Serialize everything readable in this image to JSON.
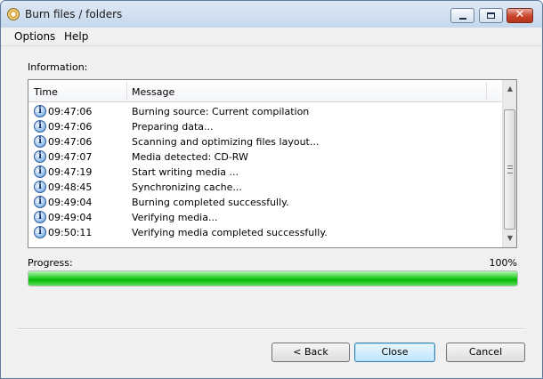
{
  "window": {
    "title": "Burn files / folders",
    "close_glyph": "✕"
  },
  "menu": {
    "options": "Options",
    "help": "Help"
  },
  "information": {
    "label": "Information:",
    "columns": {
      "time": "Time",
      "message": "Message"
    },
    "rows": [
      {
        "time": "09:47:06",
        "message": "Burning source:  Current compilation"
      },
      {
        "time": "09:47:06",
        "message": "Preparing data..."
      },
      {
        "time": "09:47:06",
        "message": "Scanning and optimizing files layout..."
      },
      {
        "time": "09:47:07",
        "message": "Media detected: CD-RW"
      },
      {
        "time": "09:47:19",
        "message": "Start writing media ..."
      },
      {
        "time": "09:48:45",
        "message": "Synchronizing cache..."
      },
      {
        "time": "09:49:04",
        "message": "Burning completed successfully."
      },
      {
        "time": "09:49:04",
        "message": "Verifying media..."
      },
      {
        "time": "09:50:11",
        "message": "Verifying media completed successfully."
      }
    ],
    "row_icon_glyph": "i"
  },
  "progress": {
    "label": "Progress:",
    "percent_text": "100%",
    "value": 1.0,
    "fill_color": "#22c722"
  },
  "buttons": {
    "back": "< Back",
    "close": "Close",
    "cancel": "Cancel"
  },
  "icons": {
    "app": "cd-disc-icon",
    "row": "info-icon",
    "scroll_up": "▲",
    "scroll_down": "▼"
  }
}
